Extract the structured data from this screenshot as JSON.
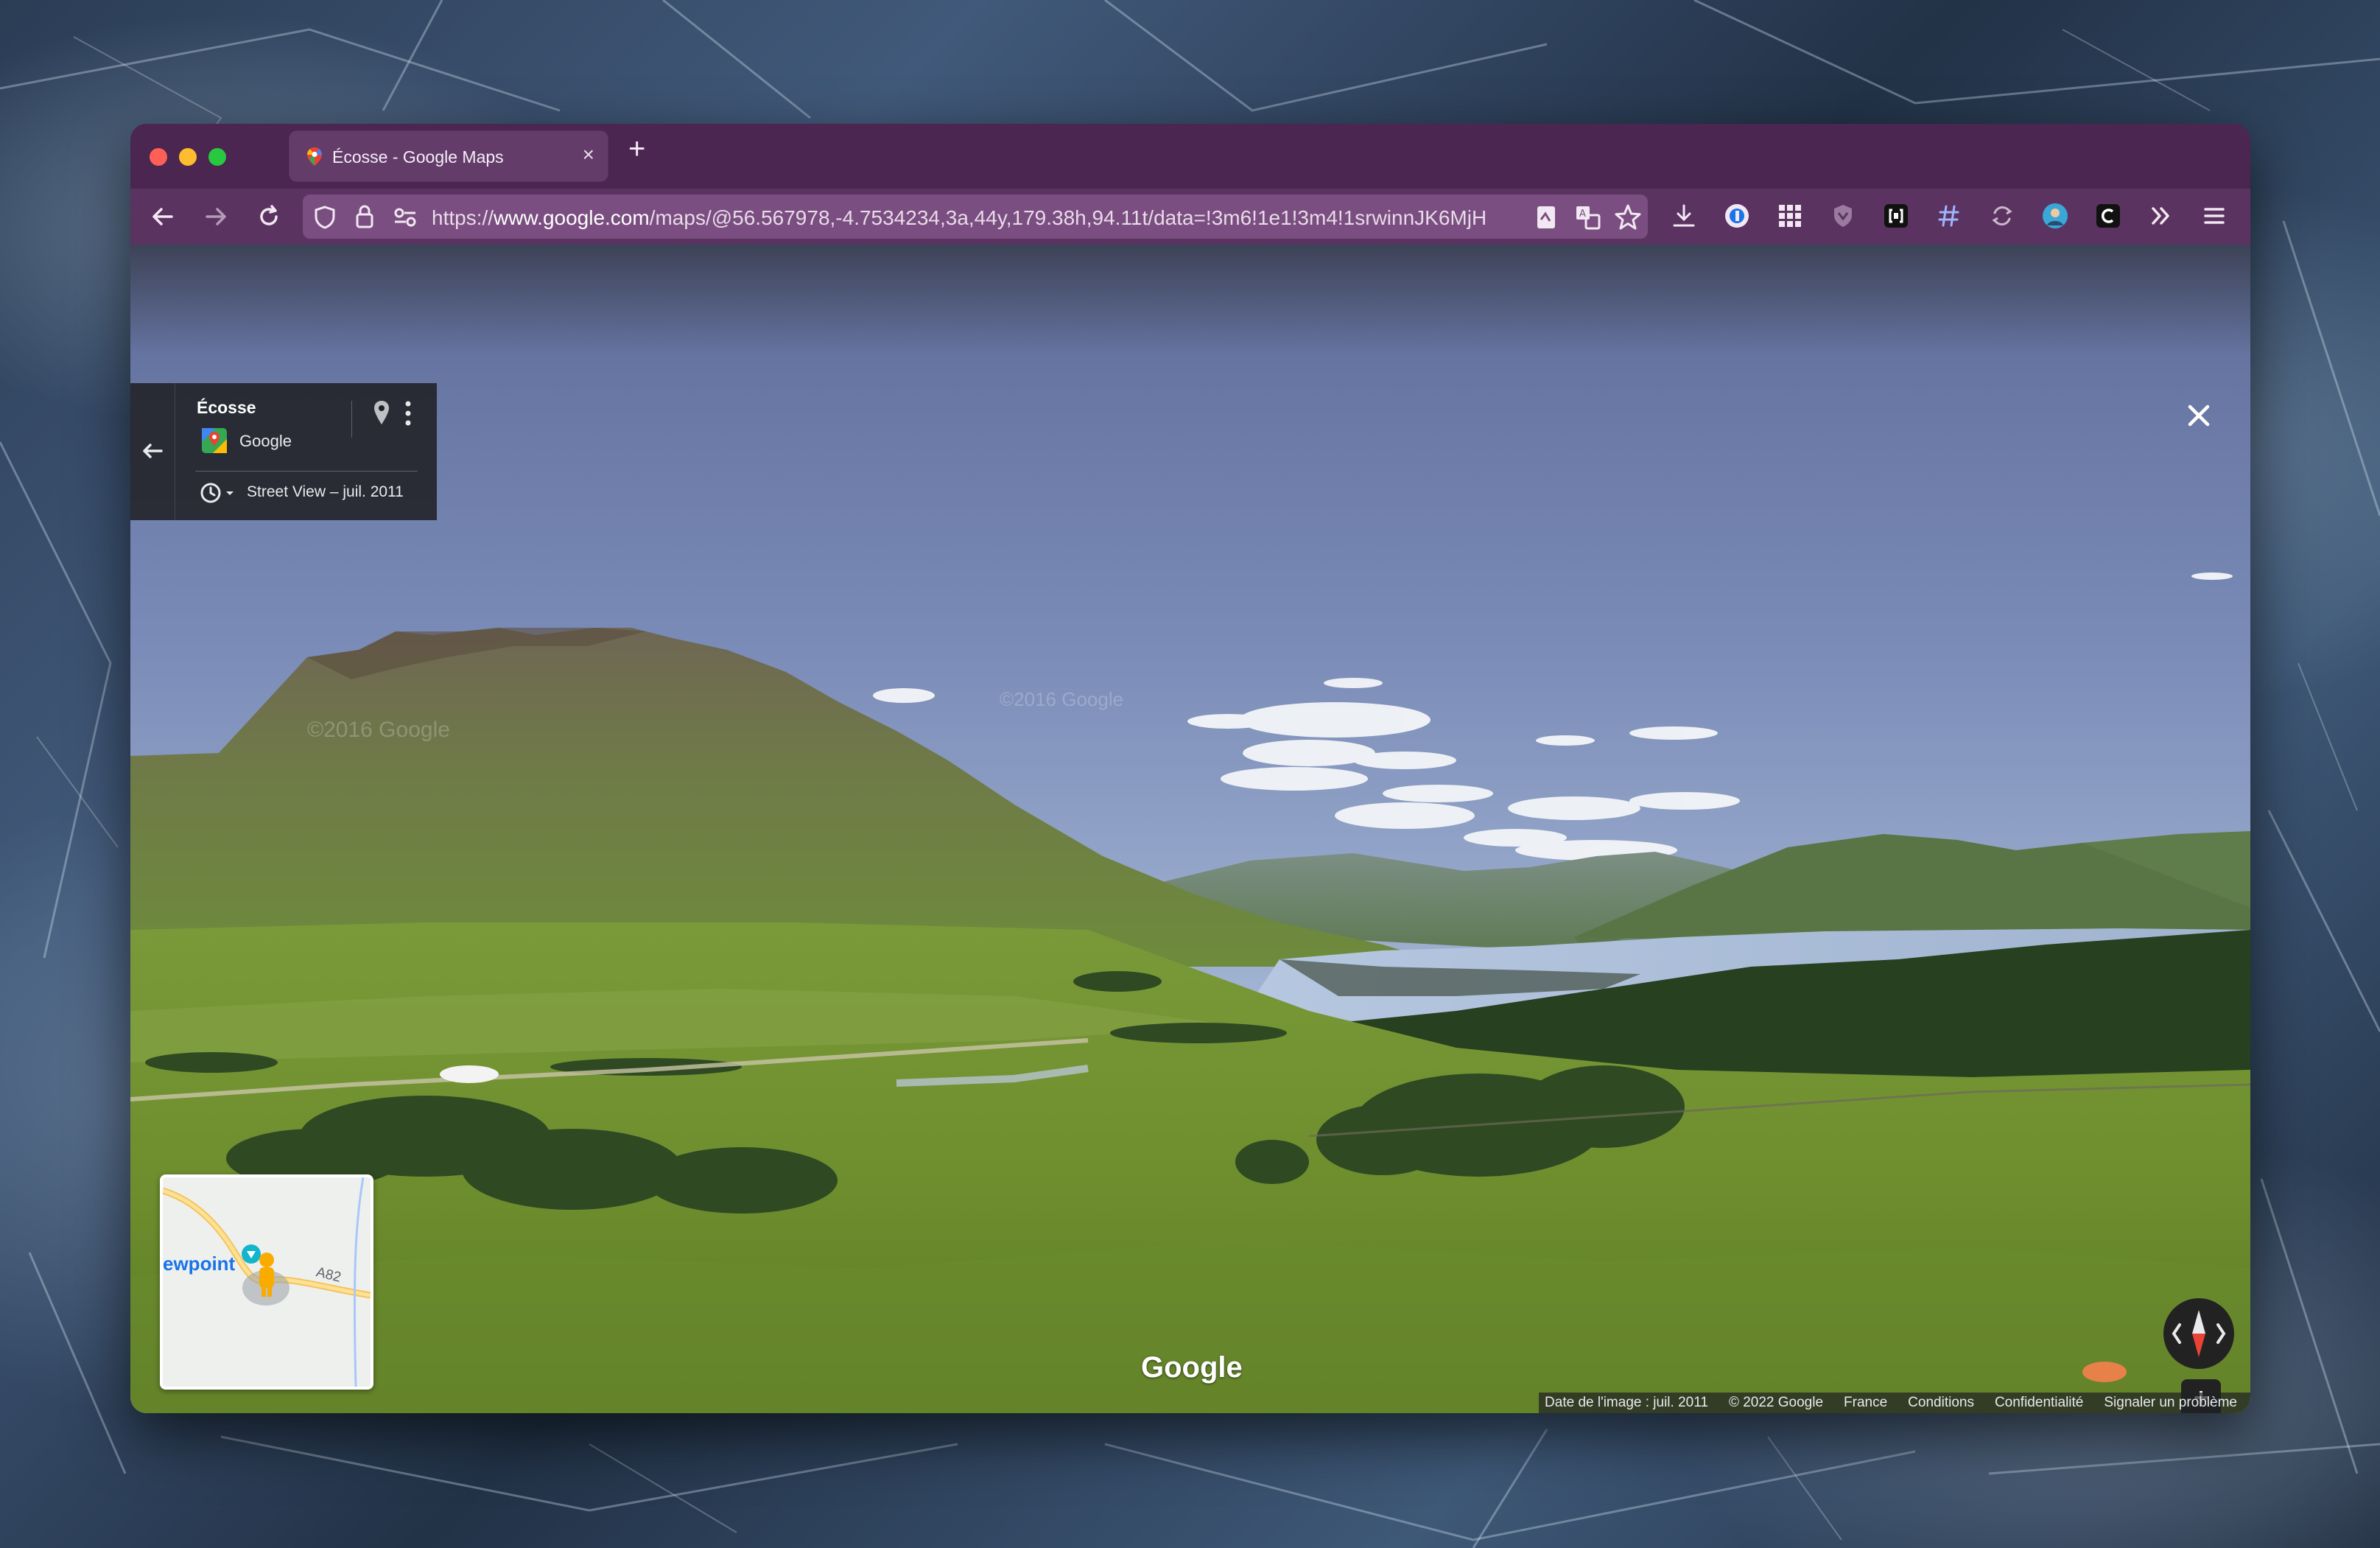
{
  "desktop": {
    "wallpaper": "frozen-ice-texture"
  },
  "browser": {
    "tab": {
      "title": "Écosse - Google Maps",
      "favicon": "google-maps-pin-icon",
      "close_label": "×"
    },
    "new_tab_label": "+",
    "nav": {
      "back_icon": "arrow-left-icon",
      "forward_icon": "arrow-right-icon",
      "reload_icon": "reload-icon"
    },
    "url": {
      "scheme": "https://",
      "host": "www.google.com",
      "path": "/maps/@56.567978,-4.7534234,3a,44y,179.38h,94.11t/data=!3m6!1e1!3m4!1srwinnJK6MjH"
    },
    "toolbar_icons": [
      "page-icon",
      "translate-icon",
      "star-icon",
      "download-icon",
      "extension-1password-icon",
      "grid-icon",
      "shield-extension-icon",
      "bracket-extension-icon",
      "hash-extension-icon",
      "sync-icon",
      "profile-avatar-icon",
      "c-extension-icon",
      "overflow-chevrons-icon",
      "hamburger-menu-icon"
    ],
    "theme_colors": {
      "tabbar": "#4a2650",
      "navbar": "#5b3360",
      "urlbar": "#7a4e80"
    }
  },
  "streetview": {
    "info_card": {
      "title": "Écosse",
      "owner": "Google",
      "date_label": "Street View – juil. 2011"
    },
    "watermarks": [
      "©2016 Google",
      "©2016 Google"
    ],
    "logo_text": "Google",
    "minimap": {
      "place_label": "ewpoint",
      "road_label": "A82"
    },
    "controls": {
      "zoom_in": "+",
      "zoom_out": "−"
    },
    "footer": {
      "image_date": "Date de l'image : juil. 2011",
      "copyright": "© 2022 Google",
      "country": "France",
      "terms": "Conditions",
      "privacy": "Confidentialité",
      "report": "Signaler un problème"
    }
  }
}
